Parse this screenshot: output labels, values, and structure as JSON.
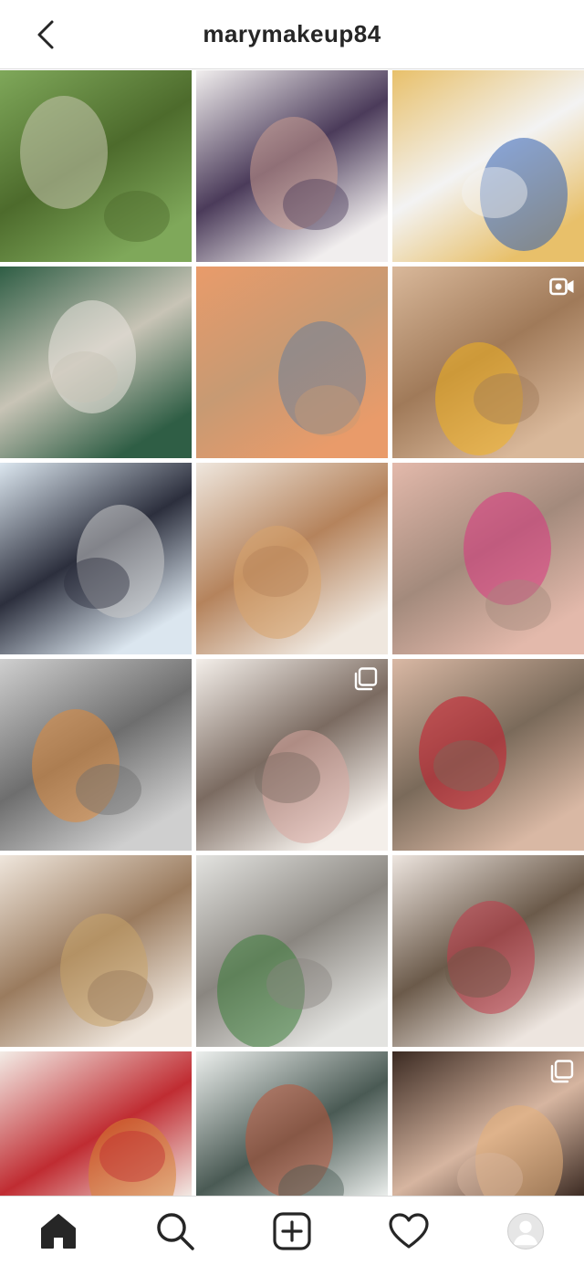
{
  "header": {
    "title": "marymakeup84",
    "back_icon": "chevron-left-icon"
  },
  "grid": {
    "tiles": [
      {
        "name": "post-landscape-donkey",
        "colors": [
          "#7fa85a",
          "#c9c7b0",
          "#4d6b2c"
        ],
        "badge": ""
      },
      {
        "name": "post-primer-products",
        "colors": [
          "#f1eeee",
          "#c99a8e",
          "#4b3b5a"
        ],
        "badge": ""
      },
      {
        "name": "post-blue-door-stairs",
        "colors": [
          "#e8c06a",
          "#2f5fb3",
          "#f3f3f3"
        ],
        "badge": ""
      },
      {
        "name": "post-edelweiss-flowers",
        "colors": [
          "#2f5e45",
          "#eae3de",
          "#c8c4b6"
        ],
        "badge": ""
      },
      {
        "name": "post-sunset-beach",
        "colors": [
          "#e99b6a",
          "#6c7f99",
          "#c79a73"
        ],
        "badge": ""
      },
      {
        "name": "post-portrait-yellow-top",
        "colors": [
          "#d9b89a",
          "#f2b21f",
          "#a07a59"
        ],
        "badge": "video-icon"
      },
      {
        "name": "post-sports-car",
        "colors": [
          "#dbe6ef",
          "#c8c8c8",
          "#2c2f3d"
        ],
        "badge": ""
      },
      {
        "name": "post-too-faced-primer",
        "colors": [
          "#efe7de",
          "#d9a46c",
          "#b5835c"
        ],
        "badge": ""
      },
      {
        "name": "post-pink-liner-makeup",
        "colors": [
          "#e3b9ab",
          "#d8357f",
          "#a38a7c"
        ],
        "badge": ""
      },
      {
        "name": "post-car-interior",
        "colors": [
          "#cfcfcf",
          "#e08a3a",
          "#6e6e6e"
        ],
        "badge": ""
      },
      {
        "name": "post-makeup-flatlay",
        "colors": [
          "#f4efea",
          "#d8a7a0",
          "#7b6b61"
        ],
        "badge": "carousel-icon"
      },
      {
        "name": "post-green-eyeshadow",
        "colors": [
          "#d9b8a4",
          "#c91a2b",
          "#7a6a5a"
        ],
        "badge": ""
      },
      {
        "name": "post-vintage-mirror",
        "colors": [
          "#efe6dc",
          "#c9a46a",
          "#9a7b5e"
        ],
        "badge": ""
      },
      {
        "name": "post-chair-plant",
        "colors": [
          "#e3e3e0",
          "#3d7d3a",
          "#8a8680"
        ],
        "badge": ""
      },
      {
        "name": "post-reindeer-sweater",
        "colors": [
          "#ede5df",
          "#c13a4a",
          "#6b5a4a"
        ],
        "badge": ""
      },
      {
        "name": "post-christmas-candy-cane",
        "colors": [
          "#f3ece6",
          "#d78433",
          "#c02c32"
        ],
        "badge": ""
      },
      {
        "name": "post-snow-house",
        "colors": [
          "#ecefed",
          "#b9553a",
          "#4a5a54"
        ],
        "badge": ""
      },
      {
        "name": "post-bokeh-eye-closeup",
        "colors": [
          "#3b2a22",
          "#e6b07a",
          "#d6b5a0"
        ],
        "badge": "carousel-icon"
      },
      {
        "name": "post-partial-1",
        "colors": [
          "#f3e6df",
          "#c02c32",
          "#e8d3c8"
        ],
        "badge": "",
        "partial": true
      },
      {
        "name": "post-partial-2",
        "colors": [
          "#ece6e0",
          "#9a8a7e",
          "#d9cfc7"
        ],
        "badge": "",
        "partial": true
      },
      {
        "name": "post-partial-3",
        "colors": [
          "#f5eee9",
          "#c02c32",
          "#e6d8cf"
        ],
        "badge": "",
        "partial": true
      }
    ]
  },
  "bottom_nav": {
    "items": [
      {
        "name": "nav-home",
        "icon": "home-icon"
      },
      {
        "name": "nav-search",
        "icon": "search-icon"
      },
      {
        "name": "nav-new-post",
        "icon": "plus-square-icon"
      },
      {
        "name": "nav-activity",
        "icon": "heart-icon"
      },
      {
        "name": "nav-profile",
        "icon": "avatar-icon"
      }
    ]
  }
}
